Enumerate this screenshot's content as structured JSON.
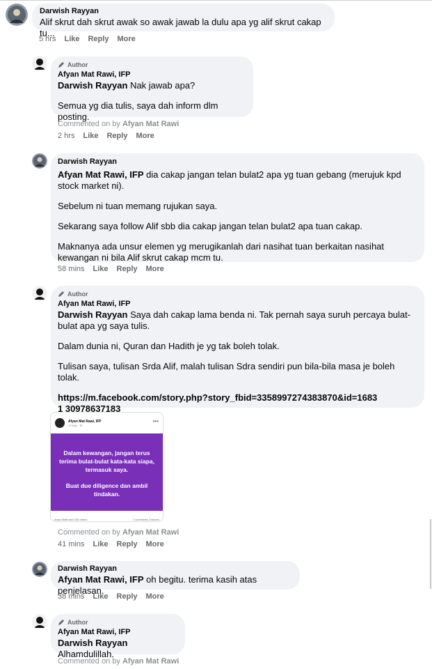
{
  "comments": [
    {
      "name": "Darwish Rayyan",
      "text": "Alif skrut dah skrut awak so awak jawab la dulu apa yg alif skrut cakap tu...",
      "time": "5 hrs",
      "like": "Like",
      "reply": "Reply",
      "more": "More"
    },
    {
      "badge": "Author",
      "name": "Afyan Mat Rawi, IFP",
      "mention": "Darwish Rayyan",
      "text": "Nak jawab apa?",
      "para2": "Semua yg dia tulis, saya dah inform dlm posting.",
      "commented_prefix": "Commented on by",
      "commented_name": "Afyan Mat Rawi",
      "time": "2 hrs",
      "like": "Like",
      "reply": "Reply",
      "more": "More"
    },
    {
      "name": "Darwish Rayyan",
      "mention": "Afyan Mat Rawi, IFP",
      "text": "dia cakap jangan telan bulat2 apa yg tuan gebang (merujuk kpd stock market ni).",
      "para2": "Sebelum ni tuan memang rujukan saya.",
      "para3": "Sekarang saya follow Alif sbb dia cakap jangan telan bulat2 apa tuan cakap.",
      "para4": "Maknanya ada unsur elemen yg merugikanlah dari nasihat tuan berkaitan nasihat kewangan ni bila Alif skrut cakap mcm tu.",
      "time": "58 mins",
      "like": "Like",
      "reply": "Reply",
      "more": "More"
    },
    {
      "badge": "Author",
      "name": "Afyan Mat Rawi, IFP",
      "mention": "Darwish Rayyan",
      "text": "Saya dah cakap lama benda ni. Tak pernah saya suruh percaya bulat-bulat apa yg saya tulis.",
      "para2": "Dalam dunia ni, Quran dan Hadith je yg tak boleh tolak.",
      "para3": "Tulisan saya, tulisan Srda Alif, malah tulisan Sdra sendiri pun bila-bila masa je boleh tolak.",
      "link": "https://m.facebook.com/story.php?story_fbid=3358997274383870&id=16831 30978637183",
      "commented_prefix": "Commented on by",
      "commented_name": "Afyan Mat Rawi",
      "time": "41 mins",
      "like": "Like",
      "reply": "Reply",
      "more": "More",
      "shared_post": {
        "author": "Afyan Mat Rawi, IFP",
        "meta": "13 May · ⚙",
        "line1": "Dalam kewangan, jangan terus terima bulat-bulat kata-kata siapa, termasuk saya.",
        "line2": "Buat due diligence dan ambil tindakan.",
        "reactions": "Anas Malik and 226 others",
        "counts": "7 comments  3 shares"
      }
    },
    {
      "name": "Darwish Rayyan",
      "mention": "Afyan Mat Rawi, IFP",
      "text": "oh begitu. terima kasih atas penjelasan.",
      "time": "38 mins",
      "like": "Like",
      "reply": "Reply",
      "more": "More"
    },
    {
      "badge": "Author",
      "name": "Afyan Mat Rawi, IFP",
      "mention": "Darwish Rayyan",
      "text": "Alhamdulillah.",
      "commented_prefix": "Commented on by",
      "commented_name": "Afyan Mat Rawi"
    }
  ],
  "colors": {
    "bubble": "#f0f2f5",
    "meta": "#65676b",
    "purple": "#7a2fb8"
  }
}
